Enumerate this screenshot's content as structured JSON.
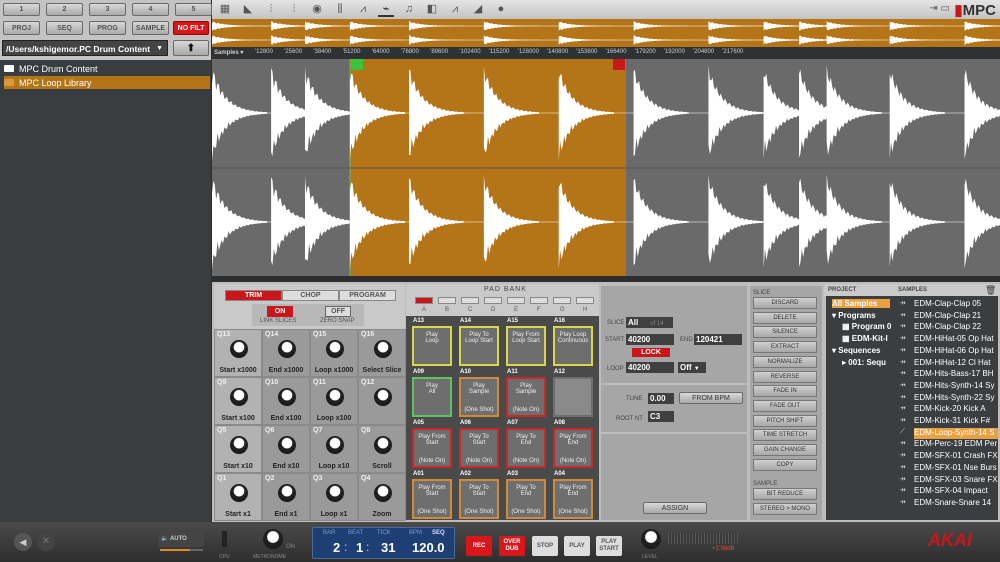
{
  "left": {
    "number_buttons": [
      "1",
      "2",
      "3",
      "4",
      "5"
    ],
    "mode_buttons": [
      "PROJ",
      "SEQ",
      "PROG",
      "SAMPLE"
    ],
    "filter_button": "NO FILT",
    "path": "/Users/kshigemor.PC Drum Content",
    "up_icon": "arrow-up-icon",
    "folders": [
      {
        "name": "MPC Drum Content",
        "selected": false
      },
      {
        "name": "MPC Loop Library",
        "selected": true
      }
    ]
  },
  "toolbar": {
    "icons": [
      "grid-icon",
      "program-edit-icon",
      "program-mixer-icon",
      "track-mixer-icon",
      "inspector-icon",
      "step-seq-icon",
      "graph-icon",
      "sample-edit-icon",
      "note-icon",
      "sample-icon",
      "pad-mute-icon",
      "next-seq-icon",
      "record-icon"
    ],
    "active": "sample-edit-icon",
    "logo": "MPC"
  },
  "ruler": {
    "unit": "Samples",
    "ticks": [
      "12800",
      "25600",
      "38400",
      "51200",
      "64000",
      "76800",
      "89600",
      "102400",
      "115200",
      "128000",
      "140800",
      "153600",
      "166400",
      "179200",
      "192000",
      "204800",
      "217600"
    ]
  },
  "colors": {
    "accent": "#b47418",
    "red": "#c8161b",
    "waveform": "#ffffff"
  },
  "trim": {
    "tabs": [
      "TRIM",
      "CHOP",
      "PROGRAM"
    ],
    "active_tab": "TRIM",
    "link_slices": {
      "value": "ON",
      "label": "LINK SLICES"
    },
    "zero_snap": {
      "value": "OFF",
      "label": "ZERO SNAP"
    },
    "knobs": [
      {
        "q": "Q13",
        "label": "Start x1000"
      },
      {
        "q": "Q14",
        "label": "End x1000"
      },
      {
        "q": "Q15",
        "label": "Loop x1000"
      },
      {
        "q": "Q16",
        "label": "Select Slice"
      },
      {
        "q": "Q9",
        "label": "Start x100"
      },
      {
        "q": "Q10",
        "label": "End x100"
      },
      {
        "q": "Q11",
        "label": "Loop x100"
      },
      {
        "q": "Q12",
        "label": ""
      },
      {
        "q": "Q5",
        "label": "Start x10"
      },
      {
        "q": "Q6",
        "label": "End x10"
      },
      {
        "q": "Q7",
        "label": "Loop x10"
      },
      {
        "q": "Q8",
        "label": "Scroll"
      },
      {
        "q": "Q1",
        "label": "Start x1"
      },
      {
        "q": "Q2",
        "label": "End x1"
      },
      {
        "q": "Q3",
        "label": "Loop x1"
      },
      {
        "q": "Q4",
        "label": "Zoom"
      }
    ]
  },
  "pads": {
    "title": "PAD BANK",
    "banks": [
      "A",
      "B",
      "C",
      "D",
      "E",
      "F",
      "G",
      "H"
    ],
    "active_bank": "A",
    "items": [
      {
        "id": "A13",
        "top": "Play",
        "mid": "Loop",
        "bottom": "",
        "color": "#d8d84a"
      },
      {
        "id": "A14",
        "top": "Play To",
        "mid": "Loop Start",
        "bottom": "",
        "color": "#d8d84a"
      },
      {
        "id": "A15",
        "top": "Play From",
        "mid": "Loop Start",
        "bottom": "",
        "color": "#d8d84a"
      },
      {
        "id": "A16",
        "top": "Play Loop",
        "mid": "Continuous",
        "bottom": "",
        "color": "#d8d84a"
      },
      {
        "id": "A09",
        "top": "Play",
        "mid": "All",
        "bottom": "",
        "color": "#5fc15f"
      },
      {
        "id": "A10",
        "top": "Play",
        "mid": "Sample",
        "bottom": "(One Shot)",
        "color": "#d08a3a"
      },
      {
        "id": "A11",
        "top": "Play",
        "mid": "Sample",
        "bottom": "(Note On)",
        "color": "#c8282a"
      },
      {
        "id": "A12",
        "top": "",
        "mid": "",
        "bottom": "",
        "color": "#6e6e6e"
      },
      {
        "id": "A05",
        "top": "Play From",
        "mid": "Start",
        "bottom": "(Note On)",
        "color": "#c8282a"
      },
      {
        "id": "A06",
        "top": "Play To",
        "mid": "Start",
        "bottom": "(Note On)",
        "color": "#c8282a"
      },
      {
        "id": "A07",
        "top": "Play To",
        "mid": "End",
        "bottom": "(Note On)",
        "color": "#c8282a"
      },
      {
        "id": "A08",
        "top": "Play From",
        "mid": "End",
        "bottom": "(Note On)",
        "color": "#c8282a"
      },
      {
        "id": "A01",
        "top": "Play From",
        "mid": "Start",
        "bottom": "(One Shot)",
        "color": "#d08a3a"
      },
      {
        "id": "A02",
        "top": "Play To",
        "mid": "Start",
        "bottom": "(One Shot)",
        "color": "#d08a3a"
      },
      {
        "id": "A03",
        "top": "Play To",
        "mid": "End",
        "bottom": "(One Shot)",
        "color": "#d08a3a"
      },
      {
        "id": "A04",
        "top": "Play From",
        "mid": "End",
        "bottom": "(One Shot)",
        "color": "#d08a3a"
      }
    ]
  },
  "slice": {
    "slice_label": "SLICE",
    "slice_value": "All",
    "slice_of": "of 14",
    "start_label": "START",
    "start": "40200",
    "end_label": "END",
    "end": "120421",
    "lock": "LOCK",
    "loop_label": "LOOP",
    "loop": "40200",
    "loop_mode": "Off",
    "tune_label": "TUNE",
    "tune": "0.00",
    "from_bpm": "FROM BPM",
    "root_label": "ROOT NT",
    "root": "C3",
    "assign": "ASSIGN"
  },
  "actions": {
    "slice_title": "SLICE",
    "slice": [
      "DISCARD",
      "DELETE",
      "SILENCE",
      "EXTRACT",
      "NORMALIZE",
      "REVERSE",
      "FADE IN",
      "FADE OUT",
      "PITCH SHIFT",
      "TIME STRETCH",
      "GAIN CHANGE",
      "COPY"
    ],
    "sample_title": "SAMPLE",
    "sample": [
      "BIT REDUCE",
      "STEREO > MONO"
    ]
  },
  "browser": {
    "project_title": "PROJECT",
    "samples_title": "SAMPLES",
    "project": [
      {
        "label": "All Samples",
        "level": 0,
        "selected": true
      },
      {
        "label": "▾ Programs",
        "level": 0
      },
      {
        "label": "Program 0",
        "level": 1
      },
      {
        "label": "EDM-Kit-I",
        "level": 1
      },
      {
        "label": "▾ Sequences",
        "level": 0
      },
      {
        "label": "▸  001: Sequ",
        "level": 1
      }
    ],
    "samples": [
      "EDM-Clap-Clap 05",
      "EDM-Clap-Clap 21",
      "EDM-Clap-Clap 22",
      "EDM-HiHat-05 Op Hat",
      "EDM-HiHat-06 Op Hat",
      "EDM-HiHat-12 Cl Hat",
      "EDM-Hits-Bass-17 BH",
      "EDM-Hits-Synth-14 Sy",
      "EDM-Hits-Synth-22 Sy",
      "EDM-Kick-20 Kick A",
      "EDM-Kick-31 Kick F#",
      "EDM-Loop-Synth-14 S",
      "EDM-Perc-19 EDM Per",
      "EDM-SFX-01 Crash FX",
      "EDM-SFX-01 Nse Burs",
      "EDM-SFX-03 Snare FX",
      "EDM-SFX-04 Impact",
      "EDM-Snare-Snare 14"
    ],
    "selected_sample": "EDM-Loop-Synth-14 S"
  },
  "transport": {
    "auto": "AUTO",
    "cpu": "CPU",
    "metronome": "METRONOME",
    "metronome_state": "ON",
    "bar_label": "BAR",
    "beat_label": "BEAT",
    "tick_label": "TICK",
    "bpm_label": "BPM",
    "seq_label": "SEQ",
    "bar": "2",
    "beat": "1",
    "tick": "31",
    "bpm": "120.0",
    "rec": "REC",
    "overdub": "OVER DUB",
    "stop": "STOP",
    "play": "PLAY",
    "play_start": "PLAY START",
    "level": "LEVEL",
    "level_db": "+2.98dB",
    "brand": "AKAI",
    "volume_level": 0.7
  }
}
